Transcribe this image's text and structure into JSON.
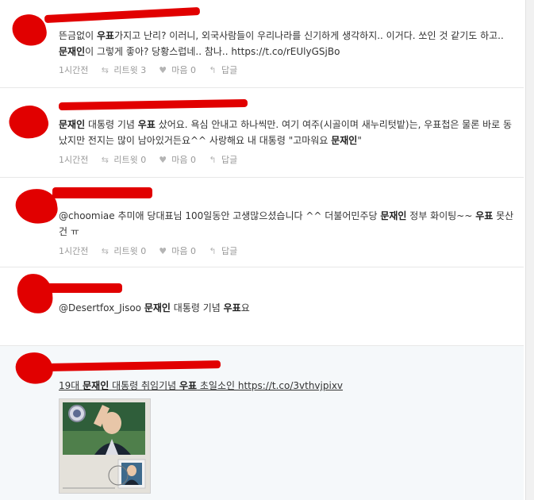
{
  "tweets": [
    {
      "text": [
        "뜬금없이 ",
        "우표",
        "가지고 난리? 이러니, 외국사람들이 우리나라를 신기하게 생각하지.. 이거다. 쏘인 것 같기도 하고.. ",
        "문재인",
        "이 그렇게 좋아? 당황스럽네.. 참나.. https://t.co/rEUlyGSjBo"
      ],
      "time": "1시간전",
      "retweet": "리트윗 3",
      "like": "마음 0",
      "reply": "답글"
    },
    {
      "text": [
        "문재인",
        " 대통령 기념 ",
        "우표",
        " 샀어요. 욕심 안내고 하나씩만. 여기 여주(시골이며 새누리텃밭)는, 우표첩은 물론 바로 동났지만 전지는 많이 남아있거든요^^ 사랑해요 내 대통령 \"고마워요 ",
        "문재인",
        "\""
      ],
      "time": "1시간전",
      "retweet": "리트윗 0",
      "like": "마음 0",
      "reply": "답글"
    },
    {
      "text": [
        "@choomiae",
        " 추미애 당대표님 100일동안 고생많으셨습니다 ^^ 더불어민주당 ",
        "문재인",
        " 정부 화이팅~~ ",
        "우표",
        " 못산건 ㅠ"
      ],
      "time": "1시간전",
      "retweet": "리트윗 0",
      "like": "마음 0",
      "reply": "답글"
    },
    {
      "text": [
        "@Desertfox_Jisoo",
        " ",
        "문재인",
        " 대통령 기념 ",
        "우표",
        "요"
      ],
      "time": "",
      "retweet": "",
      "like": "",
      "reply": ""
    },
    {
      "text": [
        "19대 ",
        "문재인",
        " 대통령 취임기념 ",
        "우표",
        " 초일소인 https://t.co/3vthvjpixv"
      ],
      "image": "stamp-photo"
    }
  ],
  "colors": {
    "redaction": "#e10000",
    "meta_text": "#999999",
    "highlight_bg": "#f5f8fa"
  },
  "icons": {
    "retweet": "retweet-icon",
    "like": "heart-icon",
    "reply": "reply-icon"
  }
}
